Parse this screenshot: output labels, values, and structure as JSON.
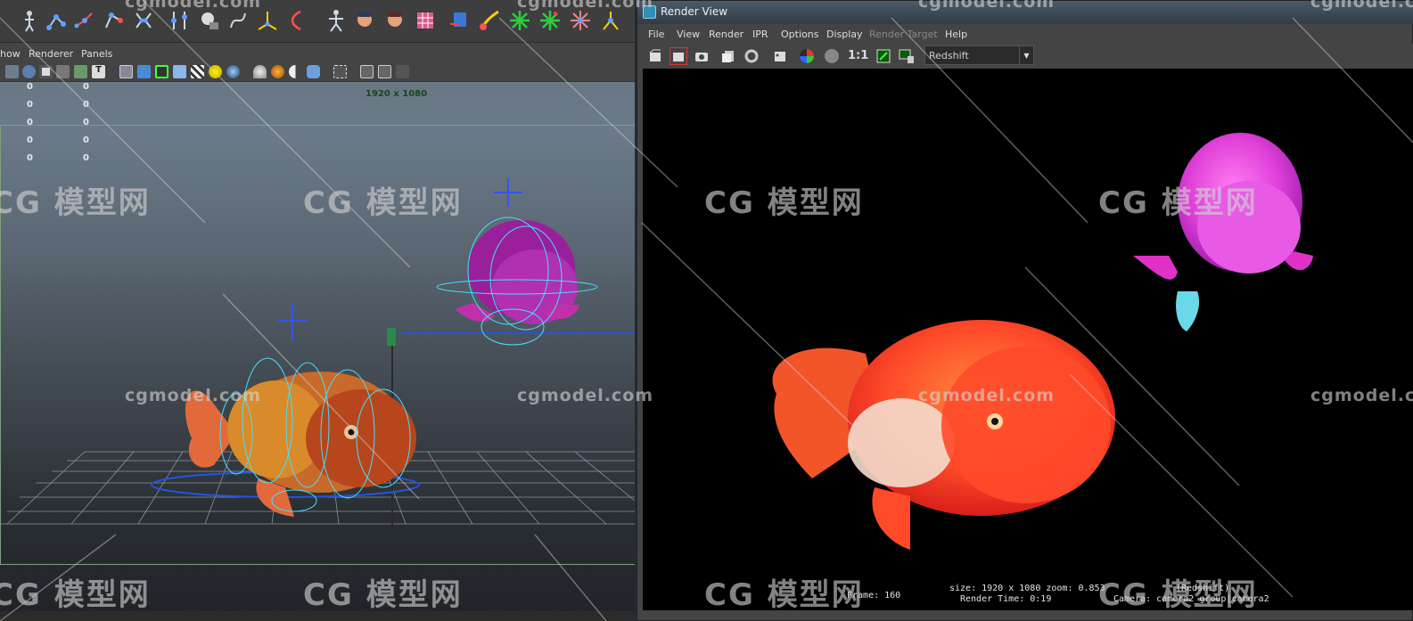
{
  "maya": {
    "panel_menu": [
      "how",
      "Renderer",
      "Panels"
    ],
    "hud_values": [
      [
        "0",
        "0"
      ],
      [
        "0",
        "0"
      ],
      [
        "0",
        "0"
      ],
      [
        "0",
        "0"
      ],
      [
        "0",
        "0"
      ]
    ],
    "resolution_gate": "1920 x 1080"
  },
  "render_view": {
    "title": "Render View",
    "menu": [
      "File",
      "View",
      "Render",
      "IPR",
      "Options",
      "Display",
      "Render Target",
      "Help"
    ],
    "ratio_label": "1:1",
    "renderer": "Redshift",
    "info": {
      "frame": "Frame: 160",
      "size": "size: 1920 x 1080 zoom: 0.853",
      "renderer_tag": "(Redshift)",
      "render_time": "Render Time: 0:19",
      "camera": "Camera: camera2_group|camera2"
    }
  },
  "watermark": {
    "logo": "CG 模型网",
    "url": "cgmodel.com"
  },
  "colors": {
    "render_background": "#000000",
    "viewport_top": "#6a7886",
    "viewport_bottom": "#202428",
    "rig_controls": "#44e0ff",
    "orange_fish": "#ff5a2a",
    "pink_fish": "#e040d8"
  }
}
